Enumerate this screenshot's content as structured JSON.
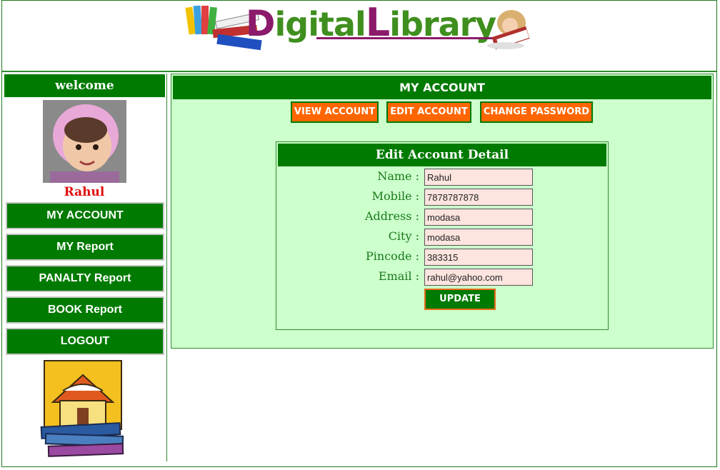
{
  "header": {
    "logo_text_d": "D",
    "logo_text_igital": "igital",
    "logo_text_l": "L",
    "logo_text_ibrary": "ibrary"
  },
  "sidebar": {
    "welcome": "welcome",
    "user_name": "Rahul",
    "nav": [
      {
        "label": "MY ACCOUNT"
      },
      {
        "label": "MY Report"
      },
      {
        "label": "PANALTY Report"
      },
      {
        "label": "BOOK Report"
      },
      {
        "label": "LOGOUT"
      }
    ]
  },
  "main": {
    "title": "MY ACCOUNT",
    "tabs": [
      {
        "label": "VIEW ACCOUNT"
      },
      {
        "label": "EDIT ACCOUNT"
      },
      {
        "label": "CHANGE PASSWORD"
      }
    ],
    "form": {
      "title": "Edit Account Detail",
      "fields": [
        {
          "label": "Name :",
          "value": "Rahul"
        },
        {
          "label": "Mobile :",
          "value": "7878787878"
        },
        {
          "label": "Address :",
          "value": "modasa"
        },
        {
          "label": "City :",
          "value": "modasa"
        },
        {
          "label": "Pincode :",
          "value": "383315"
        },
        {
          "label": "Email :",
          "value": "rahul@yahoo.com"
        }
      ],
      "submit_label": "UPDATE"
    }
  },
  "colors": {
    "primary_green": "#007a00",
    "accent_orange": "#ff6600",
    "panel_bg": "#ccffcc",
    "input_bg": "#fde4de",
    "username_red": "#e01010"
  }
}
